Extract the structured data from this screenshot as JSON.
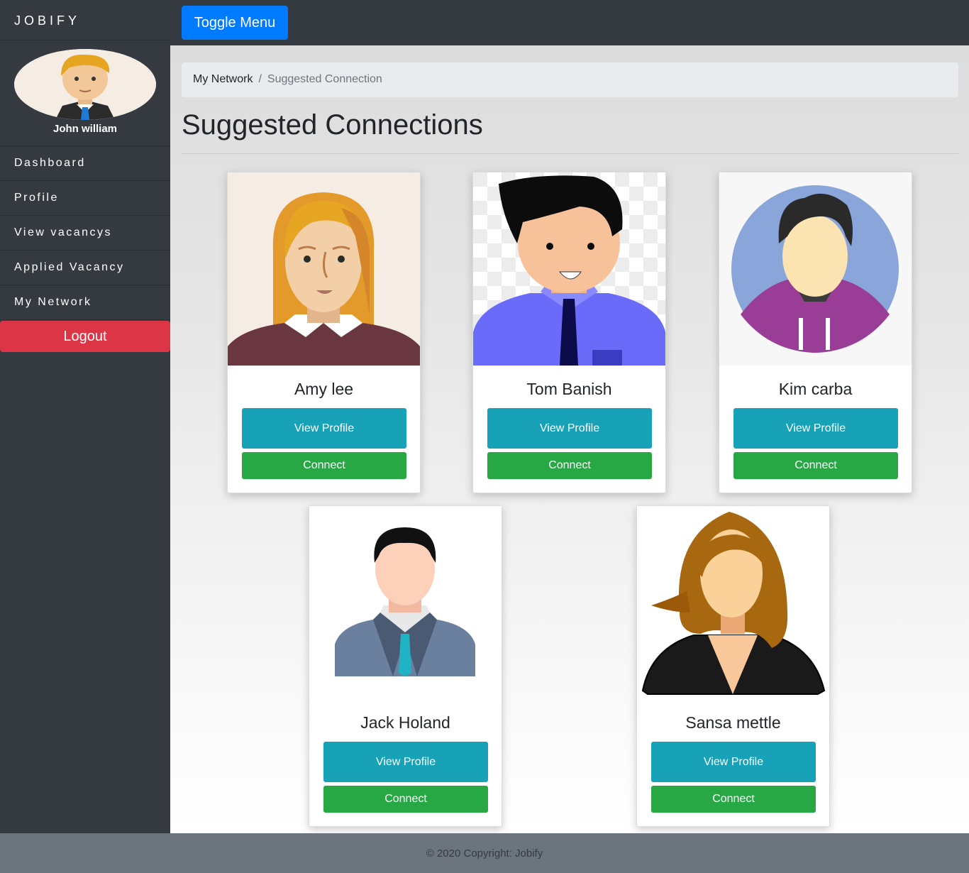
{
  "header": {
    "brand": "JOBIFY",
    "toggle_label": "Toggle Menu"
  },
  "sidebar": {
    "user_name": "John william",
    "items": [
      {
        "label": "Dashboard"
      },
      {
        "label": "Profile"
      },
      {
        "label": "View vacancys"
      },
      {
        "label": "Applied Vacancy"
      },
      {
        "label": "My Network"
      }
    ],
    "logout_label": "Logout"
  },
  "breadcrumb": {
    "parent": "My Network",
    "separator": "/",
    "current": "Suggested Connection"
  },
  "page": {
    "title": "Suggested Connections"
  },
  "connections": [
    {
      "name": "Amy lee",
      "view_label": "View Profile",
      "connect_label": "Connect"
    },
    {
      "name": "Tom Banish",
      "view_label": "View Profile",
      "connect_label": "Connect"
    },
    {
      "name": "Kim carba",
      "view_label": "View Profile",
      "connect_label": "Connect"
    },
    {
      "name": "Jack Holand",
      "view_label": "View Profile",
      "connect_label": "Connect"
    },
    {
      "name": "Sansa mettle",
      "view_label": "View Profile",
      "connect_label": "Connect"
    }
  ],
  "footer": {
    "text": "© 2020 Copyright: Jobify"
  },
  "colors": {
    "dark": "#343a40",
    "primary": "#007bff",
    "danger": "#dc3545",
    "info": "#17a2b8",
    "success": "#28a745",
    "footer": "#6c757d"
  }
}
